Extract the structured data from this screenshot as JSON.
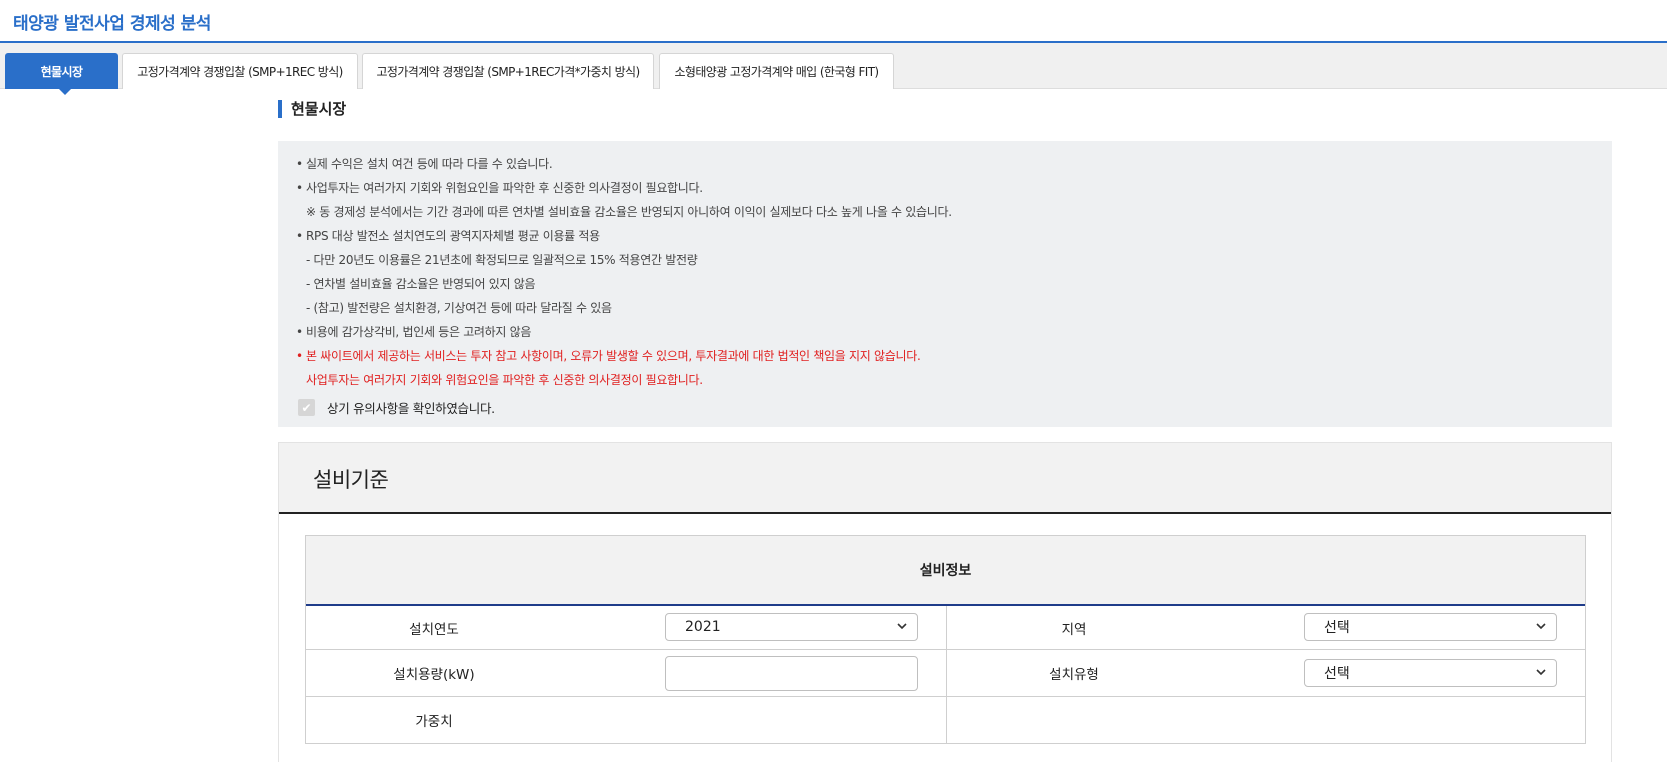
{
  "page": {
    "title": "태양광 발전사업 경제성 분석"
  },
  "tabs": [
    {
      "label": "현물시장",
      "active": true
    },
    {
      "label": "고정가격계약 경쟁입찰 (SMP+1REC 방식)",
      "active": false
    },
    {
      "label": "고정가격계약 경쟁입찰 (SMP+1REC가격*가중치 방식)",
      "active": false
    },
    {
      "label": "소형태양광 고정가격계약 매입 (한국형 FIT)",
      "active": false
    }
  ],
  "section": {
    "title": "현물시장"
  },
  "notice": {
    "lines": [
      {
        "bullet": "•",
        "text": "실제 수익은 설치 여건 등에 따라 다를 수 있습니다.",
        "red": false
      },
      {
        "bullet": "•",
        "text": "사업투자는 여러가지 기회와 위험요인을 파악한 후 신중한 의사결정이 필요합니다.",
        "red": false
      },
      {
        "bullet": "",
        "text": "※ 동 경제성 분석에서는 기간 경과에 따른 연차별 설비효율 감소율은 반영되지 아니하여 이익이 실제보다 다소 높게 나올 수 있습니다.",
        "red": false
      },
      {
        "bullet": "•",
        "text": "RPS 대상 발전소 설치연도의 광역지자체별 평균 이용률 적용",
        "red": false
      },
      {
        "bullet": "",
        "text": "- 다만 20년도 이용률은 21년초에 확정되므로 일괄적으로 15% 적용연간 발전량",
        "red": false
      },
      {
        "bullet": "",
        "text": "- 연차별 설비효율 감소율은 반영되어 있지 않음",
        "red": false
      },
      {
        "bullet": "",
        "text": "- (참고) 발전량은 설치환경, 기상여건 등에 따라 달라질 수 있음",
        "red": false
      },
      {
        "bullet": "•",
        "text": "비용에 감가상각비, 법인세 등은 고려하지 않음",
        "red": false
      },
      {
        "bullet": "•",
        "text": "본 싸이트에서 제공하는 서비스는 투자 참고 사항이며, 오류가 발생할 수 있으며, 투자결과에 대한 법적인 책임을 지지 않습니다.",
        "red": true
      },
      {
        "bullet": "",
        "text": "사업투자는 여러가지 기회와 위험요인을 파악한 후 신중한 의사결정이 필요합니다.",
        "red": true
      }
    ],
    "confirm_label": "상기 유의사항을 확인하였습니다.",
    "confirm_checked": true
  },
  "spec": {
    "title": "설비기준",
    "table_caption": "설비정보",
    "rows": {
      "install_year": {
        "label": "설치연도",
        "value": "2021"
      },
      "region": {
        "label": "지역",
        "value": "선택"
      },
      "capacity": {
        "label": "설치용량(kW)",
        "value": ""
      },
      "install_type": {
        "label": "설치유형",
        "value": "선택"
      },
      "weight": {
        "label": "가중치",
        "value": ""
      }
    }
  },
  "colors": {
    "accent": "#2a6fc9",
    "warning": "#e02020",
    "notice_bg": "#eef0f2"
  }
}
